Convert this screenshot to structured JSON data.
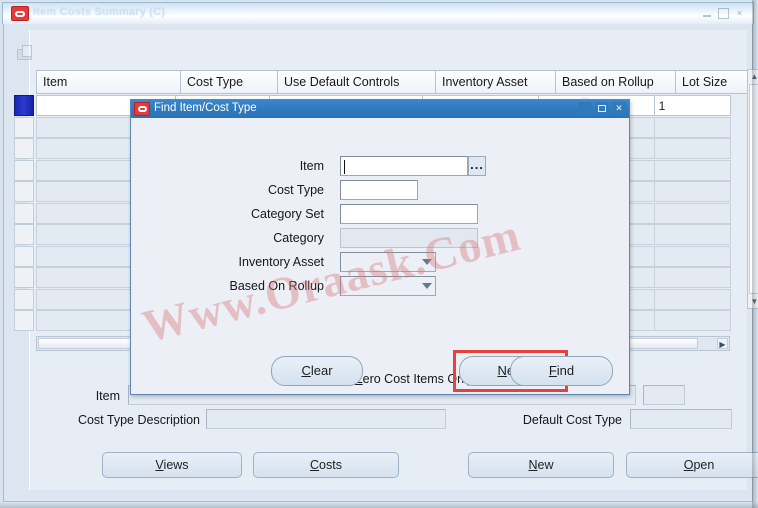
{
  "window": {
    "title": "Item Costs Summary (C)",
    "controls": {
      "minimize": "–",
      "maximize": "□",
      "close": "×"
    }
  },
  "toolbar": {
    "icon": "folder-open-icon"
  },
  "grid": {
    "columns": [
      {
        "label": "Item",
        "width": 144
      },
      {
        "label": "Cost Type",
        "width": 97
      },
      {
        "label": "Use Default Controls",
        "width": 158
      },
      {
        "label": "Inventory Asset",
        "width": 120
      },
      {
        "label": "Based on Rollup",
        "width": 120
      },
      {
        "label": "Lot Size",
        "width": 80
      }
    ],
    "rows": [
      {
        "item": "",
        "cost_type": "",
        "use_default_controls": "",
        "inventory_asset": "",
        "based_on_rollup": "",
        "lot_size": "1"
      },
      {
        "item": "",
        "cost_type": "",
        "use_default_controls": "",
        "inventory_asset": "",
        "based_on_rollup": "",
        "lot_size": ""
      },
      {
        "item": "",
        "cost_type": "",
        "use_default_controls": "",
        "inventory_asset": "",
        "based_on_rollup": "",
        "lot_size": ""
      },
      {
        "item": "",
        "cost_type": "",
        "use_default_controls": "",
        "inventory_asset": "",
        "based_on_rollup": "",
        "lot_size": ""
      },
      {
        "item": "",
        "cost_type": "",
        "use_default_controls": "",
        "inventory_asset": "",
        "based_on_rollup": "",
        "lot_size": ""
      },
      {
        "item": "",
        "cost_type": "",
        "use_default_controls": "",
        "inventory_asset": "",
        "based_on_rollup": "",
        "lot_size": ""
      },
      {
        "item": "",
        "cost_type": "",
        "use_default_controls": "",
        "inventory_asset": "",
        "based_on_rollup": "",
        "lot_size": ""
      },
      {
        "item": "",
        "cost_type": "",
        "use_default_controls": "",
        "inventory_asset": "",
        "based_on_rollup": "",
        "lot_size": ""
      },
      {
        "item": "",
        "cost_type": "",
        "use_default_controls": "",
        "inventory_asset": "",
        "based_on_rollup": "",
        "lot_size": ""
      },
      {
        "item": "",
        "cost_type": "",
        "use_default_controls": "",
        "inventory_asset": "",
        "based_on_rollup": "",
        "lot_size": ""
      },
      {
        "item": "",
        "cost_type": "",
        "use_default_controls": "",
        "inventory_asset": "",
        "based_on_rollup": "",
        "lot_size": ""
      }
    ],
    "selected_row_index": 0,
    "scroll": {
      "vertical_up": "▲",
      "vertical_down": "▼",
      "horizontal_right": "▶"
    }
  },
  "detail": {
    "item_label": "Item",
    "item_value": "",
    "cost_type_description_label": "Cost Type Description",
    "cost_type_description_value": "",
    "default_cost_type_label": "Default Cost Type",
    "default_cost_type_value": ""
  },
  "footer_buttons": [
    {
      "label": "Views",
      "accel": "V"
    },
    {
      "label": "Costs",
      "accel": "C"
    },
    {
      "label": "New",
      "accel": "N"
    },
    {
      "label": "Open",
      "accel": "O"
    }
  ],
  "dialog": {
    "title": "Find Item/Cost Type",
    "controls": {
      "minimize": "–",
      "maximize": "□",
      "close": "✕"
    },
    "fields": [
      {
        "label": "Item",
        "value": "",
        "type": "text-lov",
        "lov_glyph": "..."
      },
      {
        "label": "Cost Type",
        "value": "",
        "type": "text"
      },
      {
        "label": "Category Set",
        "value": "",
        "type": "text"
      },
      {
        "label": "Category",
        "value": "",
        "type": "text-readonly"
      },
      {
        "label": "Inventory Asset",
        "value": "",
        "type": "combo"
      },
      {
        "label": "Based On Rollup",
        "value": "",
        "type": "combo"
      }
    ],
    "checkbox": {
      "label": "Zero Cost Items Only",
      "accel": "Z",
      "checked": false
    },
    "buttons": [
      {
        "label": "Clear",
        "accel": "C",
        "focused": false
      },
      {
        "label": "New",
        "accel": "N",
        "focused": true
      },
      {
        "label": "Find",
        "accel": "F",
        "focused": false
      }
    ]
  },
  "watermark": {
    "text": "Www.Oraask.Com"
  },
  "colors": {
    "dialog_titlebar": "#2f79bd",
    "focus_ring": "#e8403a",
    "row_selector": "#1a28b8",
    "oracle_red": "#e33b3b"
  }
}
